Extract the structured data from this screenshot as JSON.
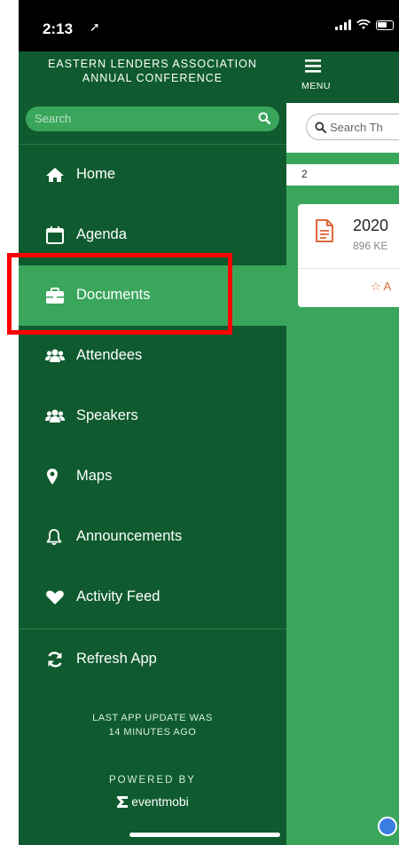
{
  "status_bar": {
    "time": "2:13",
    "location_arrow": "➚"
  },
  "sidebar": {
    "title_line1": "EASTERN LENDERS ASSOCIATION",
    "title_line2": "ANNUAL CONFERENCE",
    "search_placeholder": "Search",
    "items": [
      {
        "label": "Home",
        "icon": "home-icon"
      },
      {
        "label": "Agenda",
        "icon": "calendar-icon"
      },
      {
        "label": "Documents",
        "icon": "briefcase-icon"
      },
      {
        "label": "Attendees",
        "icon": "users-icon"
      },
      {
        "label": "Speakers",
        "icon": "users-icon"
      },
      {
        "label": "Maps",
        "icon": "map-pin-icon"
      },
      {
        "label": "Announcements",
        "icon": "bell-icon"
      },
      {
        "label": "Activity Feed",
        "icon": "heart-icon"
      },
      {
        "label": "Refresh App",
        "icon": "refresh-icon"
      }
    ],
    "update_line1": "LAST APP UPDATE WAS",
    "update_line2": "14 MINUTES AGO",
    "powered_by": "POWERED BY",
    "brand": "eventmobi"
  },
  "content": {
    "menu_label": "MENU",
    "search_placeholder": "Search Th",
    "count": "2",
    "document": {
      "title": "2020",
      "size": "896 KE",
      "action": "☆ A"
    }
  },
  "colors": {
    "sidebar": "#0f5b2f",
    "accent": "#3aa65c",
    "highlight": "#ff0000"
  }
}
